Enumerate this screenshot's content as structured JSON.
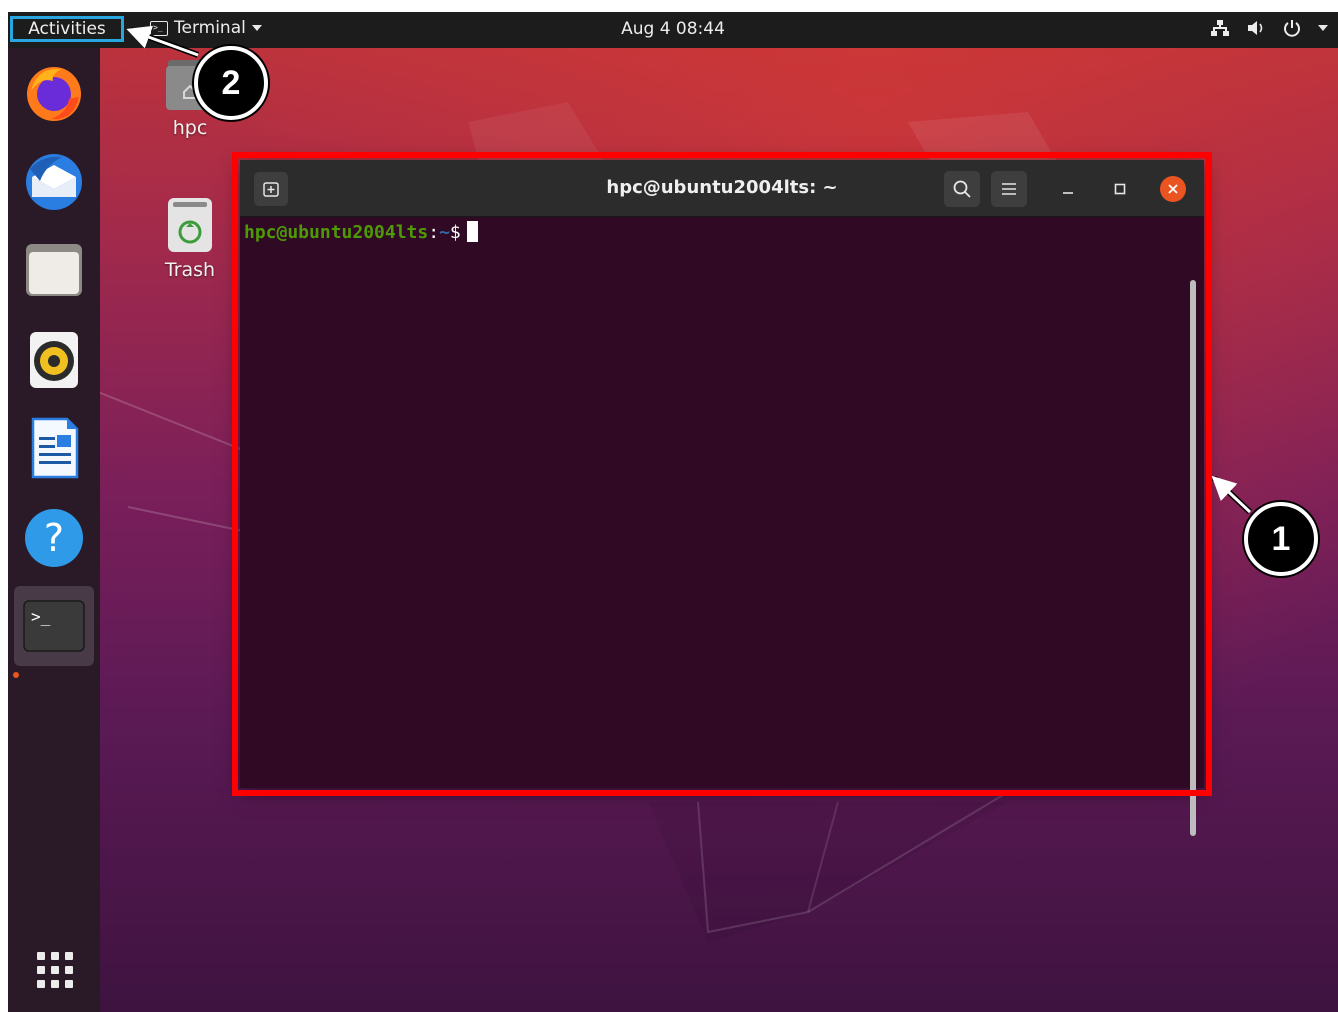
{
  "topbar": {
    "activities_label": "Activities",
    "app_menu_label": "Terminal",
    "clock": "Aug 4  08:44",
    "tray_icons": [
      "network-icon",
      "volume-icon",
      "power-icon",
      "chevron-down-icon"
    ]
  },
  "dock": {
    "items": [
      {
        "name": "Firefox",
        "icon": "firefox-icon"
      },
      {
        "name": "Thunderbird",
        "icon": "thunderbird-icon"
      },
      {
        "name": "Files",
        "icon": "files-icon"
      },
      {
        "name": "Rhythmbox",
        "icon": "rhythmbox-icon"
      },
      {
        "name": "LibreOffice Writer",
        "icon": "writer-icon"
      },
      {
        "name": "Help",
        "icon": "help-icon"
      },
      {
        "name": "Terminal",
        "icon": "terminal-icon",
        "running": true
      }
    ],
    "apps_grid_icon": "show-applications-icon"
  },
  "desktop": {
    "icons": [
      {
        "label": "hpc",
        "icon": "home-folder-icon"
      },
      {
        "label": "Trash",
        "icon": "trash-icon"
      }
    ]
  },
  "terminal": {
    "title": "hpc@ubuntu2004lts: ~",
    "prompt_user": "hpc@ubuntu2004lts",
    "prompt_sep": ":",
    "prompt_path": "~",
    "prompt_symbol": "$",
    "header_icons": [
      "new-tab-icon",
      "search-icon",
      "hamburger-menu-icon"
    ],
    "window_controls": [
      "minimize-icon",
      "maximize-icon",
      "close-icon"
    ]
  },
  "annotations": {
    "callout_1": "1",
    "callout_2": "2",
    "highlight_color": "#ff0000",
    "activities_highlight_color": "#27a6e0"
  },
  "colors": {
    "terminal_bg": "#300a24",
    "prompt_user": "#4e9a06",
    "prompt_path": "#3465a4",
    "accent": "#e95420"
  }
}
